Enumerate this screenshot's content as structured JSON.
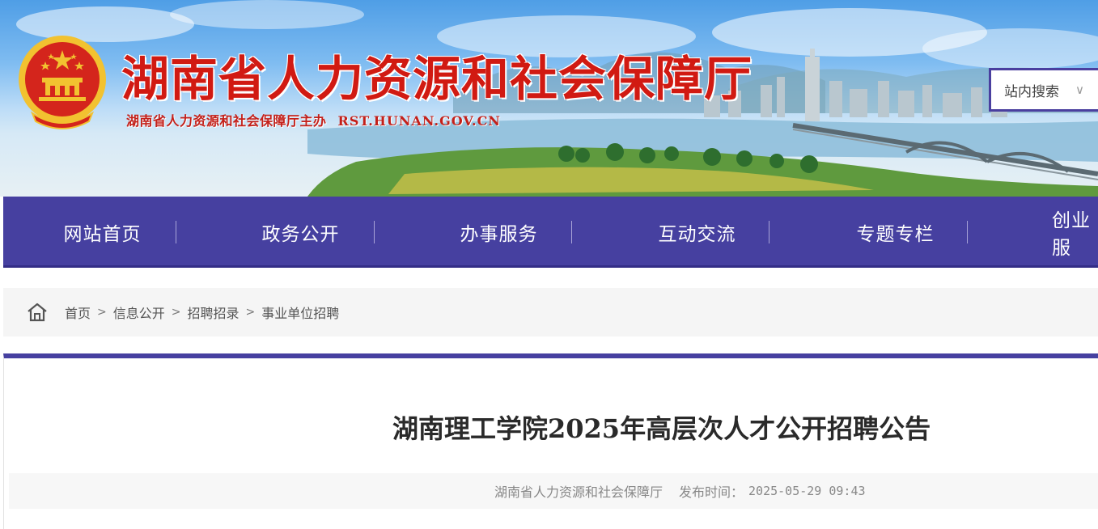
{
  "header": {
    "site_title": "湖南省人力资源和社会保障厅",
    "site_subtitle": "湖南省人力资源和社会保障厅主办",
    "site_domain": "RST.HUNAN.GOV.CN",
    "search_label": "站内搜索",
    "search_chevron": "∨"
  },
  "nav": {
    "items": [
      {
        "label": "网站首页"
      },
      {
        "label": "政务公开"
      },
      {
        "label": "办事服务"
      },
      {
        "label": "互动交流"
      },
      {
        "label": "专题专栏"
      },
      {
        "label": "创业服"
      }
    ]
  },
  "breadcrumb": {
    "items": [
      "首页",
      "信息公开",
      "招聘招录",
      "事业单位招聘"
    ],
    "separator": ">"
  },
  "article": {
    "title": "湖南理工学院2025年高层次人才公开招聘公告",
    "source": "湖南省人力资源和社会保障厅",
    "publish_label": "发布时间：",
    "publish_time": "2025-05-29 09:43"
  },
  "colors": {
    "nav_bg": "#4640a0",
    "title_red": "#d11a12",
    "emblem_red": "#d4251c",
    "emblem_gold": "#f2c230"
  }
}
